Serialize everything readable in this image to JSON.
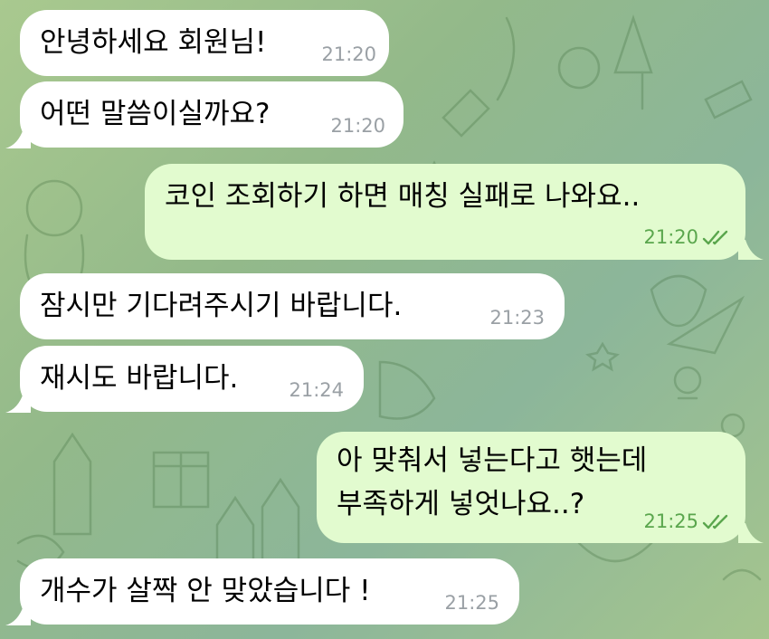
{
  "theme": {
    "incoming_bg": "#ffffff",
    "outgoing_bg": "#e2fbcf",
    "incoming_time_color": "#9aa0a5",
    "outgoing_time_color": "#5aa64d",
    "chat_bg": "#9cbe8e"
  },
  "messages": [
    {
      "direction": "in",
      "text": "안녕하세요 회원님!",
      "time": "21:20"
    },
    {
      "direction": "in",
      "text": "어떤 말씀이실까요?",
      "time": "21:20"
    },
    {
      "direction": "out",
      "text": "코인 조회하기 하면 매칭 실패로 나와요..",
      "time": "21:20",
      "status": "read-double-check"
    },
    {
      "direction": "in",
      "text": "잠시만 기다려주시기 바랍니다.",
      "time": "21:23"
    },
    {
      "direction": "in",
      "text": "재시도 바랍니다.",
      "time": "21:24"
    },
    {
      "direction": "out",
      "lines": [
        "아 맞춰서 넣는다고 햇는데",
        "부족하게 넣엇나요..?"
      ],
      "time": "21:25",
      "status": "read-double-check"
    },
    {
      "direction": "in",
      "text": "개수가 살짝 안 맞았습니다 !",
      "time": "21:25"
    }
  ],
  "icons": {
    "read_receipt": "double-check-icon",
    "background": "doodle-pattern"
  }
}
